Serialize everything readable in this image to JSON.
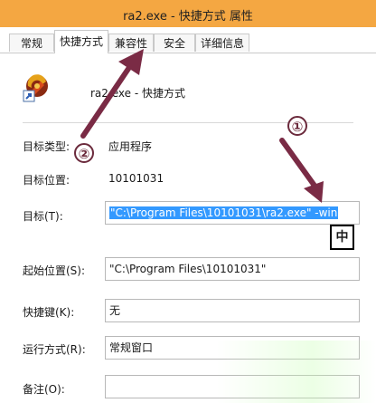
{
  "window": {
    "title": "ra2.exe - 快捷方式 属性"
  },
  "tabs": [
    {
      "label": "常规"
    },
    {
      "label": "快捷方式"
    },
    {
      "label": "兼容性"
    },
    {
      "label": "安全"
    },
    {
      "label": "详细信息"
    }
  ],
  "header": {
    "name": "ra2.exe - 快捷方式"
  },
  "fields": {
    "target_type": {
      "label": "目标类型:",
      "value": "应用程序"
    },
    "target_location": {
      "label": "目标位置:",
      "value": "10101031"
    },
    "target": {
      "label": "目标(T):",
      "value": "\"C:\\Program Files\\10101031\\ra2.exe\" -win"
    },
    "start_in": {
      "label": "起始位置(S):",
      "value": "\"C:\\Program Files\\10101031\""
    },
    "shortcut_key": {
      "label": "快捷键(K):",
      "value": "无"
    },
    "run": {
      "label": "运行方式(R):",
      "value": "常规窗口"
    },
    "comment": {
      "label": "备注(O):",
      "value": ""
    }
  },
  "ime_indicator": "中",
  "annotations": {
    "marker_1": "①",
    "marker_2": "②"
  },
  "colors": {
    "titlebar": "#f4a742",
    "selection": "#3399ff",
    "arrow": "#7a2b45"
  }
}
